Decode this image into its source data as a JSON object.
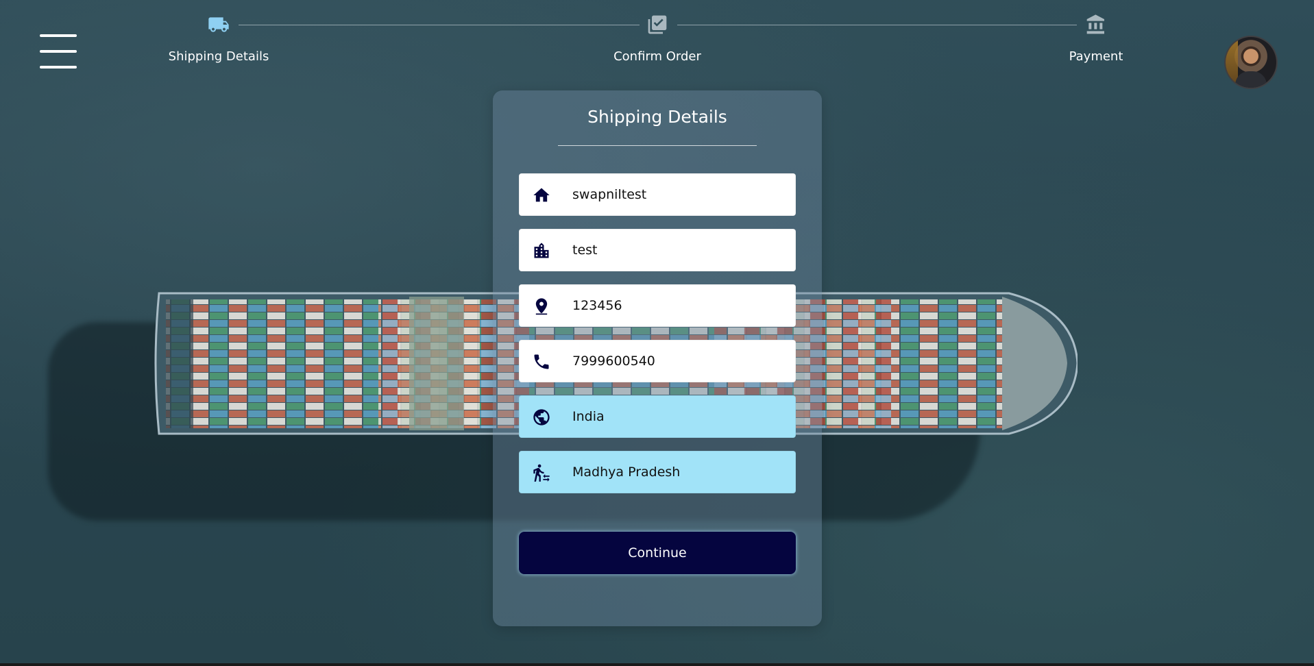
{
  "stepper": {
    "steps": [
      {
        "label": "Shipping Details",
        "icon": "truck-icon",
        "active": true
      },
      {
        "label": "Confirm Order",
        "icon": "checklist-icon",
        "active": false
      },
      {
        "label": "Payment",
        "icon": "bank-icon",
        "active": false
      }
    ]
  },
  "form": {
    "title": "Shipping Details",
    "fields": [
      {
        "name": "address",
        "icon": "home-icon",
        "value": "swapniltest",
        "type": "input"
      },
      {
        "name": "city",
        "icon": "city-icon",
        "value": "test",
        "type": "input"
      },
      {
        "name": "pincode",
        "icon": "location-pin-icon",
        "value": "123456",
        "type": "input"
      },
      {
        "name": "phone",
        "icon": "phone-icon",
        "value": "7999600540",
        "type": "input"
      },
      {
        "name": "country",
        "icon": "globe-icon",
        "value": "India",
        "type": "select"
      },
      {
        "name": "state",
        "icon": "transfer-within-station-icon",
        "value": "Madhya Pradesh",
        "type": "select"
      }
    ],
    "submit_label": "Continue"
  },
  "colors": {
    "active_step": "#8fd0f2",
    "inactive_step": "#aab8bf",
    "select_bg": "#a1e3f8",
    "button_bg": "#05053f",
    "icon": "#05053f"
  }
}
